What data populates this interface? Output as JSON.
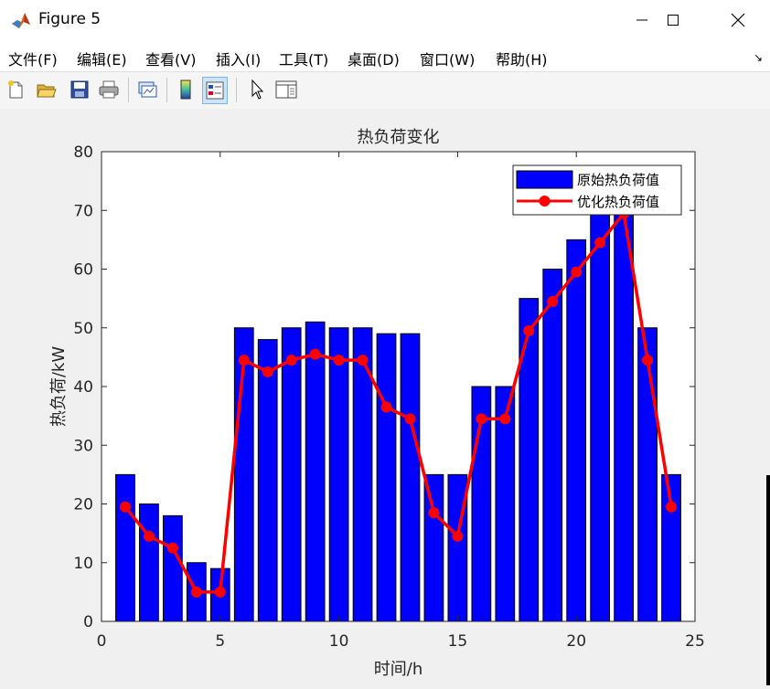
{
  "window": {
    "title": "Figure 5",
    "controls": [
      "minimize",
      "maximize",
      "close"
    ]
  },
  "menu": {
    "items": [
      "文件(F)",
      "编辑(E)",
      "查看(V)",
      "插入(I)",
      "工具(T)",
      "桌面(D)",
      "窗口(W)",
      "帮助(H)"
    ],
    "dock_glyph": "↘"
  },
  "toolbar": {
    "buttons": [
      {
        "name": "new-figure",
        "icon": "new-file-icon"
      },
      {
        "name": "open-file",
        "icon": "open-folder-icon"
      },
      {
        "name": "save",
        "icon": "save-icon"
      },
      {
        "name": "print",
        "icon": "print-icon"
      },
      {
        "name": "link-plot",
        "icon": "link-plot-icon"
      },
      {
        "name": "insert-colorbar",
        "icon": "colorbar-icon"
      },
      {
        "name": "insert-legend",
        "icon": "legend-icon"
      },
      {
        "name": "edit-plot",
        "icon": "pointer-icon"
      },
      {
        "name": "property-inspector",
        "icon": "property-inspector-icon"
      }
    ]
  },
  "colors": {
    "bar_fill": "#0000ff",
    "line": "#ff0000",
    "axes_bg": "#ffffff",
    "figure_bg": "#f0f0f0"
  },
  "chart_data": {
    "type": "bar",
    "title": "热负荷变化",
    "xlabel": "时间/h",
    "ylabel": "热负荷/kW",
    "xlim": [
      0,
      25
    ],
    "ylim": [
      0,
      80
    ],
    "xticks": [
      0,
      5,
      10,
      15,
      20,
      25
    ],
    "yticks": [
      0,
      10,
      20,
      30,
      40,
      50,
      60,
      70,
      80
    ],
    "x": [
      1,
      2,
      3,
      4,
      5,
      6,
      7,
      8,
      9,
      10,
      11,
      12,
      13,
      14,
      15,
      16,
      17,
      18,
      19,
      20,
      21,
      22,
      23,
      24
    ],
    "series": [
      {
        "name": "原始热负荷值",
        "type": "bar",
        "color": "#0000ff",
        "values": [
          25,
          20,
          18,
          10,
          9,
          50,
          48,
          50,
          51,
          50,
          50,
          49,
          49,
          25,
          25,
          40,
          40,
          55,
          60,
          65,
          70,
          70,
          50,
          25
        ]
      },
      {
        "name": "优化热负荷值",
        "type": "line",
        "color": "#ff0000",
        "marker": "circle",
        "values": [
          19.5,
          14.5,
          12.5,
          5,
          5,
          44.5,
          42.5,
          44.5,
          45.5,
          44.5,
          44.5,
          36.5,
          34.5,
          18.5,
          14.5,
          34.5,
          34.5,
          49.5,
          54.5,
          59.5,
          64.5,
          69.5,
          44.5,
          19.5
        ]
      }
    ],
    "legend": "top-right",
    "grid": false
  }
}
